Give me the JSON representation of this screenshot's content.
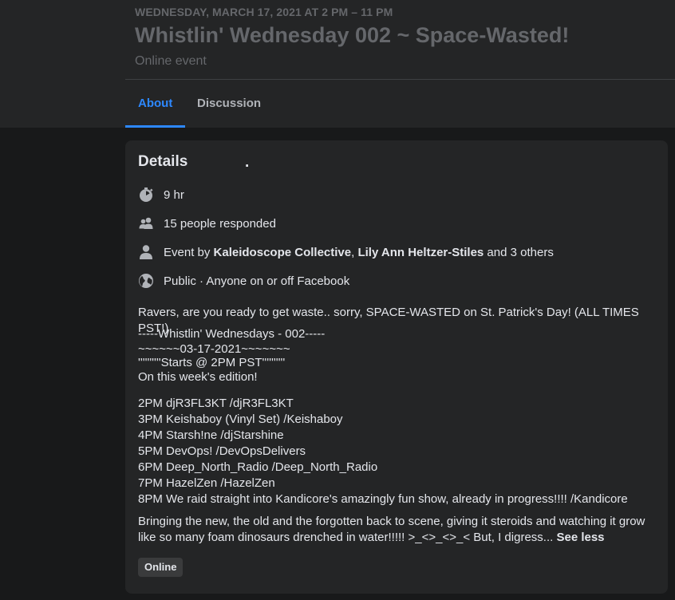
{
  "header": {
    "date": "WEDNESDAY, MARCH 17, 2021 AT 2 PM – 11 PM",
    "title": "Whistlin' Wednesday 002 ~ Space-Wasted!",
    "subtitle": "Online event"
  },
  "tabs": [
    {
      "label": "About",
      "active": true
    },
    {
      "label": "Discussion",
      "active": false
    }
  ],
  "details": {
    "title": "Details",
    "dot": ".",
    "duration": {
      "icon": "stopwatch-icon",
      "text": "9 hr"
    },
    "responded": {
      "icon": "people-icon",
      "text": "15 people responded"
    },
    "hosts": {
      "icon": "person-icon",
      "prefix": "Event by ",
      "host1": "Kaleidoscope Collective",
      "sep": ", ",
      "host2": "Lily Ann Heltzer-Stiles",
      "suffix": " and 3 others"
    },
    "privacy": {
      "icon": "globe-icon",
      "text": "Public · Anyone on or off Facebook"
    },
    "intro": "Ravers, are you ready to get waste.. sorry, SPACE-WASTED on St. Patrick's Day! (ALL TIMES PST!)",
    "block1": [
      "-----Whistlin' Wednesdays - 002-----",
      "~~~~~~03-17-2021~~~~~~~",
      "''''''''''Starts @ 2PM PST''''''''''",
      "On this week's edition!"
    ],
    "lineup": [
      "2PM djR3FL3KT /djR3FL3KT",
      "3PM Keishaboy (Vinyl Set) /Keishaboy",
      "4PM Starsh!ne /djStarshine",
      "5PM DevOps! /DevOpsDelivers",
      "6PM Deep_North_Radio /Deep_North_Radio",
      "7PM HazelZen /HazelZen",
      "8PM We raid straight into Kandicore's amazingly fun show, already in progress!!!! /Kandicore"
    ],
    "closing": "Bringing the new, the old and the forgotten back to scene, giving it steroids and watching it grow like so many foam dinosaurs drenched in water!!!!! >_<>_<>_< But, I digress...",
    "see_less": "See less",
    "tag": "Online"
  },
  "colors": {
    "background": "#18191a",
    "surface": "#242526",
    "accent": "#2d88ff",
    "text": "#e4e6eb",
    "muted": "#65676b",
    "icon": "#b0b3b8"
  }
}
